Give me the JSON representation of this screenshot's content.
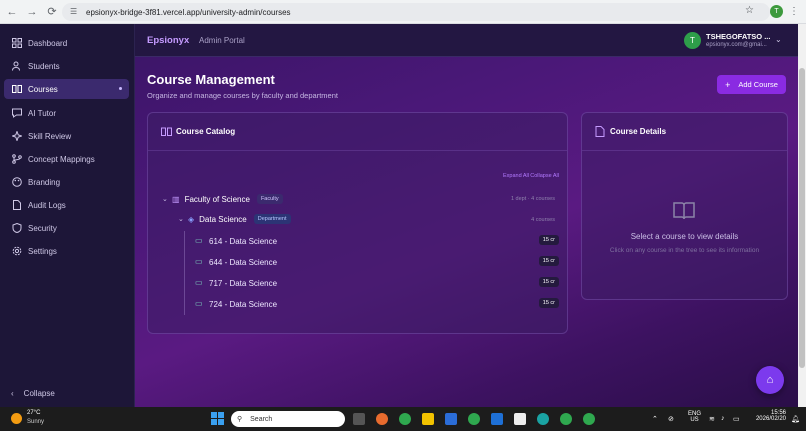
{
  "browser": {
    "url": "epsionyx-bridge-3f81.vercel.app/university-admin/courses",
    "profile_initial": "T"
  },
  "sidebar": {
    "items": [
      {
        "label": "Dashboard",
        "icon": "grid-icon"
      },
      {
        "label": "Students",
        "icon": "users-icon"
      },
      {
        "label": "Courses",
        "icon": "book-icon"
      },
      {
        "label": "AI Tutor",
        "icon": "chat-icon"
      },
      {
        "label": "Skill Review",
        "icon": "sparkle-icon"
      },
      {
        "label": "Concept Mappings",
        "icon": "branch-icon"
      },
      {
        "label": "Branding",
        "icon": "palette-icon"
      },
      {
        "label": "Audit Logs",
        "icon": "file-icon"
      },
      {
        "label": "Security",
        "icon": "shield-icon"
      },
      {
        "label": "Settings",
        "icon": "gear-icon"
      }
    ],
    "active": "Courses",
    "collapse_label": "Collapse"
  },
  "topbar": {
    "brand": "Epsionyx",
    "portal": "Admin Portal",
    "user_initial": "T",
    "user_name": "TSHEGOFATSO ...",
    "user_email": "epsionyx.com@gmai..."
  },
  "page": {
    "title": "Course Management",
    "subtitle": "Organize and manage courses by faculty and department",
    "add_button": "Add Course"
  },
  "catalog": {
    "title": "Course Catalog",
    "expand_all": "Expand All",
    "collapse_all": "Collapse All",
    "faculty": {
      "name": "Faculty of Science",
      "badge": "Faculty",
      "meta": "1 dept · 4 courses"
    },
    "department": {
      "name": "Data Science",
      "badge": "Department",
      "meta": "4 courses"
    },
    "courses": [
      {
        "label": "614 - Data Science",
        "credits": "15 cr"
      },
      {
        "label": "644 - Data Science",
        "credits": "15 cr"
      },
      {
        "label": "717 - Data Science",
        "credits": "15 cr"
      },
      {
        "label": "724 - Data Science",
        "credits": "15 cr"
      }
    ]
  },
  "details": {
    "title": "Course Details",
    "empty_message": "Select a course to view details",
    "empty_sub": "Click on any course in the tree to see its information"
  },
  "taskbar": {
    "temp": "27°C",
    "condition": "Sunny",
    "search_placeholder": "Search",
    "lang": "ENG",
    "region": "US",
    "time": "15:56",
    "date": "2026/02/20"
  },
  "colors": {
    "accent": "#8a2be2",
    "brand": "#c59bff",
    "sidebar_bg": "#1d1638"
  }
}
